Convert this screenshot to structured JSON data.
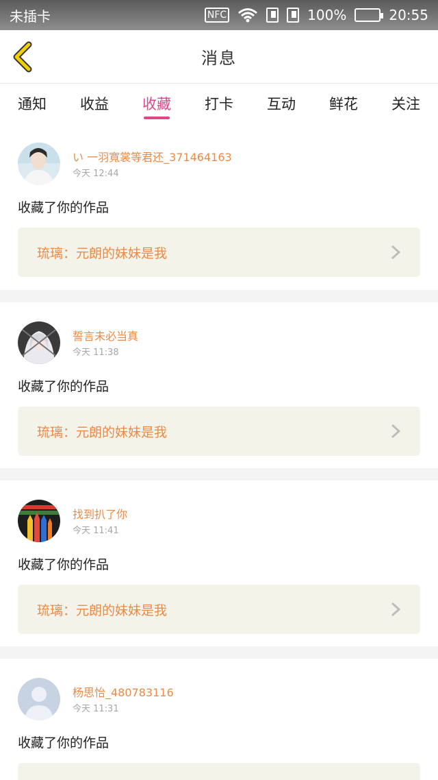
{
  "status_bar": {
    "carrier": "未插卡",
    "nfc": "NFC",
    "battery": "100%",
    "time": "20:55"
  },
  "header": {
    "title": "消息"
  },
  "tabs": [
    {
      "label": "通知",
      "active": false
    },
    {
      "label": "收益",
      "active": false
    },
    {
      "label": "收藏",
      "active": true
    },
    {
      "label": "打卡",
      "active": false
    },
    {
      "label": "互动",
      "active": false
    },
    {
      "label": "鲜花",
      "active": false
    },
    {
      "label": "关注",
      "active": false
    }
  ],
  "accent_color": "#e0468b",
  "name_color": "#ec8a45",
  "messages": [
    {
      "username": "い 一羽寬裳等君还_371464163",
      "time": "今天 12:44",
      "action": "收藏了你的作品",
      "work": "琉璃：元朗的妹妹是我",
      "avatar": "portrait-avatar"
    },
    {
      "username": "誓言未必当真",
      "time": "今天 11:38",
      "action": "收藏了你的作品",
      "work": "琉璃：元朗的妹妹是我",
      "avatar": "anime-avatar"
    },
    {
      "username": "找到扒了你",
      "time": "今天 11:41",
      "action": "收藏了你的作品",
      "work": "琉璃：元朗的妹妹是我",
      "avatar": "pencils-avatar"
    },
    {
      "username": "杨思怡_480783116",
      "time": "今天 11:31",
      "action": "收藏了你的作品",
      "work": "",
      "avatar": "default-avatar"
    }
  ]
}
